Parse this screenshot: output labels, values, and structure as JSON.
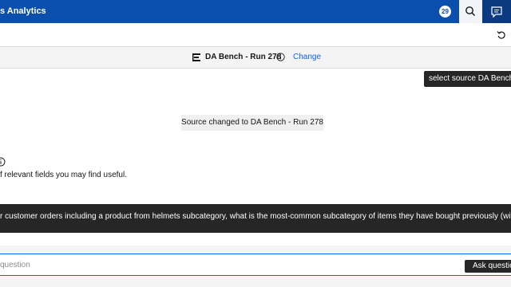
{
  "header": {
    "app_title": "s Analytics",
    "notification_count": "29",
    "accent_color": "#0b4fac"
  },
  "icons": {
    "search": "search-icon",
    "chat": "chat-icon",
    "refresh": "refresh-icon",
    "source": "data-source-icon",
    "info": "info-icon"
  },
  "source_bar": {
    "source_name": "DA Bench - Run 278",
    "change_label": "Change"
  },
  "tooltip": {
    "text": "select source DA Bench -"
  },
  "conversation": {
    "status_message": "Source changed to DA Bench - Run 278",
    "hint_text": "f relevant fields you may find useful.",
    "question_text": "r customer orders including a product from helmets subcategory, what is the most-common subcategory of items they have bought previously (with any ins"
  },
  "input": {
    "placeholder": "question",
    "ask_label": "Ask questio"
  }
}
